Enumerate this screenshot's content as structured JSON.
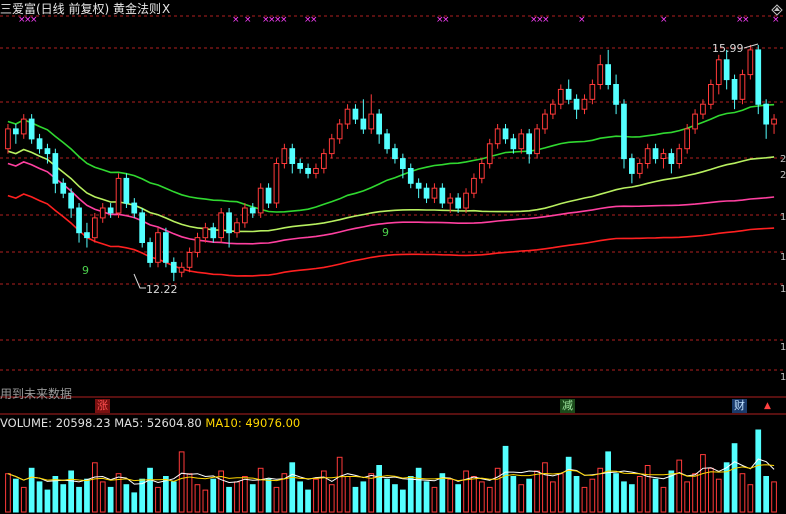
{
  "header": {
    "title": "三爱富(日线 前复权) 黄金法则",
    "close_label": "X"
  },
  "annotations": {
    "high_label": "15.99",
    "low_label": "12.22",
    "signal_a": "9",
    "signal_b": "9"
  },
  "future_note": "用到未来数据",
  "badges": {
    "zhang": "涨",
    "jian": "减",
    "cai": "财"
  },
  "volume_line": {
    "volume_label": "VOLUME:",
    "volume_value": "20598.23",
    "ma5_label": "MA5:",
    "ma5_value": "52604.80",
    "ma10_label": "MA10:",
    "ma10_value": "49076.00"
  },
  "right_labels": [
    "2",
    "2",
    "1",
    "1",
    "1",
    "1",
    "1"
  ],
  "colors": {
    "up": "#ff3a3a",
    "down": "#54ffff",
    "ma_green": "#30d830",
    "ma_lightgreen": "#b8f060",
    "ma_magenta": "#ff40a0",
    "ma_red": "#ff2020",
    "grid": "#b02020",
    "event_marker": "#ff40ff",
    "vol_ma5": "#ffffff",
    "vol_ma10": "#ffd700"
  },
  "chart_data": {
    "type": "candlestick",
    "low_marker": 12.22,
    "high_marker": 15.99,
    "candles": [
      [
        14.9,
        15.3,
        15.4,
        14.8
      ],
      [
        15.3,
        15.2,
        15.4,
        15.0
      ],
      [
        15.2,
        15.5,
        15.6,
        15.1
      ],
      [
        15.5,
        15.1,
        15.6,
        15.0
      ],
      [
        15.1,
        14.9,
        15.2,
        14.8
      ],
      [
        14.9,
        14.8,
        15.0,
        14.6
      ],
      [
        14.8,
        14.2,
        14.9,
        14.0
      ],
      [
        14.2,
        14.0,
        14.3,
        13.9
      ],
      [
        14.0,
        13.7,
        14.1,
        13.5
      ],
      [
        13.7,
        13.2,
        13.8,
        13.0
      ],
      [
        13.2,
        13.1,
        13.4,
        12.9
      ],
      [
        13.1,
        13.5,
        13.6,
        13.0
      ],
      [
        13.5,
        13.7,
        13.8,
        13.4
      ],
      [
        13.7,
        13.6,
        13.8,
        13.5
      ],
      [
        13.6,
        14.3,
        14.4,
        13.5
      ],
      [
        14.3,
        13.8,
        14.4,
        13.7
      ],
      [
        13.8,
        13.6,
        13.9,
        13.5
      ],
      [
        13.6,
        13.0,
        13.7,
        12.9
      ],
      [
        13.0,
        12.6,
        13.1,
        12.5
      ],
      [
        12.6,
        13.2,
        13.3,
        12.5
      ],
      [
        13.2,
        12.6,
        13.3,
        12.5
      ],
      [
        12.6,
        12.4,
        12.7,
        12.22
      ],
      [
        12.4,
        12.5,
        12.6,
        12.3
      ],
      [
        12.5,
        12.8,
        12.9,
        12.4
      ],
      [
        12.8,
        13.1,
        13.2,
        12.7
      ],
      [
        13.1,
        13.3,
        13.4,
        13.0
      ],
      [
        13.3,
        13.1,
        13.4,
        13.0
      ],
      [
        13.1,
        13.6,
        13.7,
        13.0
      ],
      [
        13.6,
        13.2,
        13.7,
        12.9
      ],
      [
        13.2,
        13.4,
        13.5,
        13.1
      ],
      [
        13.4,
        13.7,
        13.8,
        13.3
      ],
      [
        13.7,
        13.6,
        13.8,
        13.5
      ],
      [
        13.6,
        14.1,
        14.2,
        13.5
      ],
      [
        14.1,
        13.8,
        14.2,
        13.7
      ],
      [
        13.8,
        14.6,
        14.7,
        13.7
      ],
      [
        14.6,
        14.9,
        15.0,
        14.5
      ],
      [
        14.9,
        14.6,
        15.0,
        14.4
      ],
      [
        14.6,
        14.5,
        14.7,
        14.4
      ],
      [
        14.5,
        14.4,
        14.6,
        14.3
      ],
      [
        14.4,
        14.5,
        14.6,
        14.3
      ],
      [
        14.5,
        14.8,
        14.9,
        14.4
      ],
      [
        14.8,
        15.1,
        15.2,
        14.7
      ],
      [
        15.1,
        15.4,
        15.5,
        15.0
      ],
      [
        15.4,
        15.7,
        15.8,
        15.3
      ],
      [
        15.7,
        15.5,
        15.8,
        15.4
      ],
      [
        15.5,
        15.3,
        15.9,
        15.2
      ],
      [
        15.3,
        15.6,
        16.0,
        15.2
      ],
      [
        15.6,
        15.2,
        15.7,
        15.0
      ],
      [
        15.2,
        14.9,
        15.3,
        14.8
      ],
      [
        14.9,
        14.7,
        15.0,
        14.6
      ],
      [
        14.7,
        14.5,
        14.8,
        14.3
      ],
      [
        14.5,
        14.2,
        14.6,
        14.1
      ],
      [
        14.2,
        14.1,
        14.3,
        13.9
      ],
      [
        14.1,
        13.9,
        14.2,
        13.8
      ],
      [
        13.9,
        14.1,
        14.2,
        13.8
      ],
      [
        14.1,
        13.8,
        14.2,
        13.7
      ],
      [
        13.8,
        13.9,
        14.0,
        13.6
      ],
      [
        13.9,
        13.7,
        14.0,
        13.6
      ],
      [
        13.7,
        14.0,
        14.1,
        13.6
      ],
      [
        14.0,
        14.3,
        14.4,
        13.9
      ],
      [
        14.3,
        14.6,
        14.7,
        14.2
      ],
      [
        14.6,
        15.0,
        15.1,
        14.5
      ],
      [
        15.0,
        15.3,
        15.4,
        14.9
      ],
      [
        15.3,
        15.1,
        15.4,
        15.0
      ],
      [
        15.1,
        14.9,
        15.2,
        14.8
      ],
      [
        14.9,
        15.2,
        15.3,
        14.8
      ],
      [
        15.2,
        14.8,
        15.3,
        14.6
      ],
      [
        14.8,
        15.3,
        15.4,
        14.7
      ],
      [
        15.3,
        15.6,
        15.7,
        15.2
      ],
      [
        15.6,
        15.8,
        15.9,
        15.5
      ],
      [
        15.8,
        16.1,
        16.2,
        15.7
      ],
      [
        16.1,
        15.9,
        16.3,
        15.8
      ],
      [
        15.9,
        15.7,
        16.0,
        15.5
      ],
      [
        15.7,
        15.9,
        16.0,
        15.6
      ],
      [
        15.9,
        16.2,
        16.3,
        15.8
      ],
      [
        16.2,
        16.6,
        16.8,
        16.1
      ],
      [
        16.6,
        16.2,
        16.9,
        16.1
      ],
      [
        16.2,
        15.8,
        16.4,
        15.6
      ],
      [
        15.8,
        14.7,
        15.9,
        14.5
      ],
      [
        14.7,
        14.4,
        14.8,
        14.2
      ],
      [
        14.4,
        14.6,
        14.7,
        14.3
      ],
      [
        14.6,
        14.9,
        15.0,
        14.5
      ],
      [
        14.9,
        14.7,
        15.0,
        14.6
      ],
      [
        14.7,
        14.8,
        14.9,
        14.5
      ],
      [
        14.8,
        14.6,
        14.9,
        14.4
      ],
      [
        14.6,
        14.9,
        15.0,
        14.5
      ],
      [
        14.9,
        15.3,
        15.4,
        14.8
      ],
      [
        15.3,
        15.6,
        15.7,
        15.2
      ],
      [
        15.6,
        15.8,
        15.9,
        15.5
      ],
      [
        15.8,
        16.2,
        16.3,
        15.7
      ],
      [
        16.2,
        16.7,
        16.8,
        16.0
      ],
      [
        16.7,
        16.3,
        16.9,
        16.1
      ],
      [
        16.3,
        15.9,
        16.4,
        15.7
      ],
      [
        15.9,
        16.4,
        16.5,
        15.8
      ],
      [
        16.4,
        16.9,
        17.0,
        16.3
      ],
      [
        16.9,
        15.8,
        17.0,
        15.6
      ],
      [
        15.8,
        15.4,
        15.9,
        15.1
      ],
      [
        15.4,
        15.5,
        15.6,
        15.2
      ]
    ],
    "volume": [
      14,
      12,
      9,
      16,
      11,
      8,
      13,
      10,
      15,
      9,
      12,
      18,
      11,
      9,
      14,
      10,
      7,
      12,
      16,
      9,
      13,
      11,
      22,
      14,
      10,
      8,
      12,
      15,
      9,
      11,
      13,
      10,
      16,
      12,
      9,
      14,
      18,
      11,
      8,
      12,
      15,
      10,
      20,
      13,
      9,
      11,
      14,
      17,
      12,
      10,
      8,
      13,
      16,
      11,
      9,
      14,
      12,
      10,
      15,
      13,
      11,
      9,
      16,
      24,
      13,
      10,
      12,
      15,
      18,
      11,
      14,
      20,
      13,
      9,
      12,
      16,
      22,
      14,
      11,
      10,
      13,
      17,
      12,
      9,
      15,
      19,
      11,
      14,
      21,
      16,
      12,
      18,
      25,
      14,
      10,
      30,
      13,
      11
    ]
  }
}
